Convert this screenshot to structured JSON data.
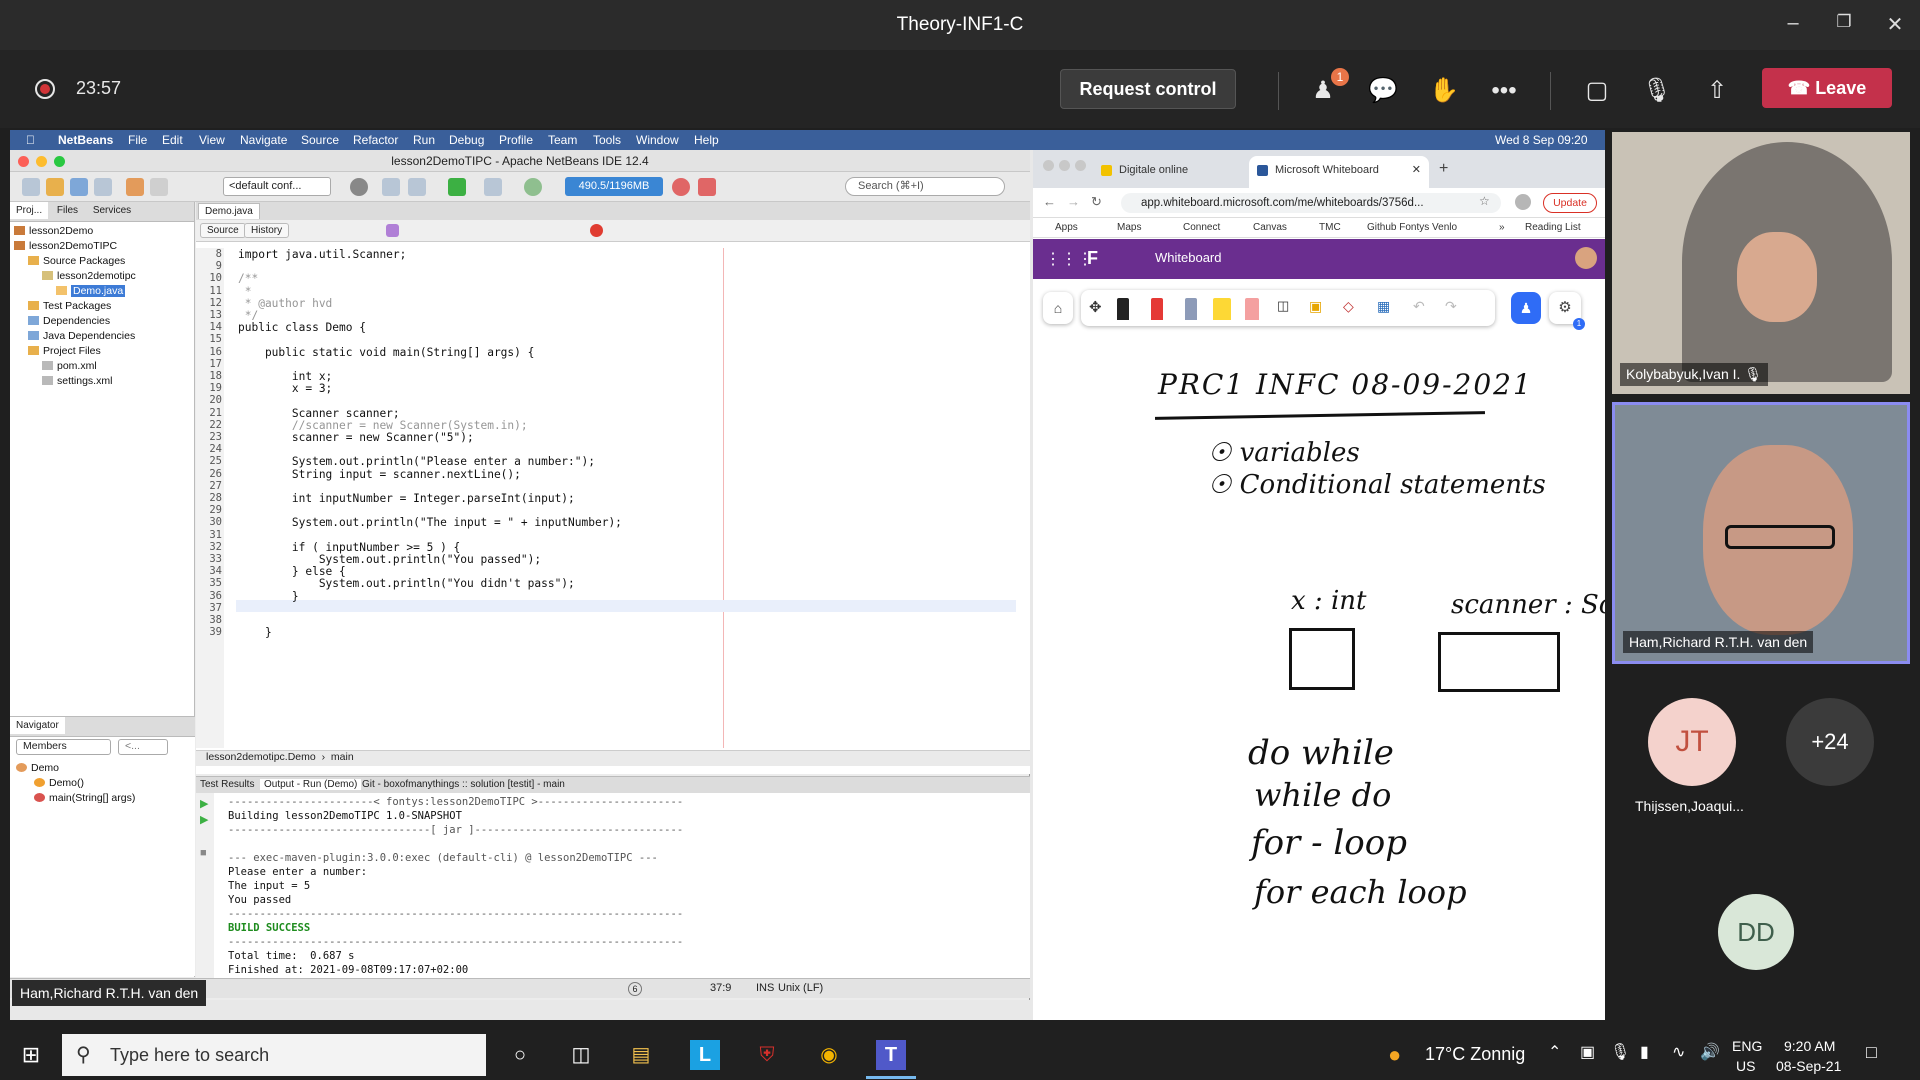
{
  "window": {
    "title": "Theory-INF1-C"
  },
  "call": {
    "timer": "23:57",
    "request_control": "Request control",
    "participants_badge": "1",
    "leave": "Leave",
    "shared_by": "Ham,Richard R.T.H. van den"
  },
  "mac_menubar": {
    "app": "NetBeans",
    "menus": [
      "File",
      "Edit",
      "View",
      "Navigate",
      "Source",
      "Refactor",
      "Run",
      "Debug",
      "Profile",
      "Team",
      "Tools",
      "Window",
      "Help"
    ],
    "clock": "Wed 8 Sep  09:20"
  },
  "netbeans": {
    "title": "lesson2DemoTIPC - Apache NetBeans IDE 12.4",
    "config": "<default conf...",
    "memory": "490.5/1196MB",
    "search_placeholder": "Search (⌘+I)",
    "panel_tabs": [
      "Proj...",
      "Files",
      "Services"
    ],
    "project_tree": [
      "lesson2Demo",
      "lesson2DemoTIPC",
      "Source Packages",
      "lesson2demotipc",
      "Demo.java",
      "Test Packages",
      "Dependencies",
      "Java Dependencies",
      "Project Files",
      "pom.xml",
      "settings.xml"
    ],
    "navigator": {
      "title": "Navigator",
      "filter": "Members",
      "filter2": "<...",
      "items": [
        "Demo",
        "Demo()",
        "main(String[] args)"
      ]
    },
    "editor_tab": "Demo.java",
    "source_tab": "Source",
    "history_tab": "History",
    "code_lines": [
      {
        "n": "8",
        "text": "import java.util.Scanner;"
      },
      {
        "n": "9",
        "text": ""
      },
      {
        "n": "10",
        "text": "/**"
      },
      {
        "n": "11",
        "text": " *"
      },
      {
        "n": "12",
        "text": " * @author hvd"
      },
      {
        "n": "13",
        "text": " */"
      },
      {
        "n": "14",
        "text": "public class Demo {"
      },
      {
        "n": "15",
        "text": ""
      },
      {
        "n": "16",
        "text": "    public static void main(String[] args) {"
      },
      {
        "n": "17",
        "text": ""
      },
      {
        "n": "18",
        "text": "        int x;"
      },
      {
        "n": "19",
        "text": "        x = 3;"
      },
      {
        "n": "20",
        "text": ""
      },
      {
        "n": "21",
        "text": "        Scanner scanner;"
      },
      {
        "n": "22",
        "text": "        //scanner = new Scanner(System.in);"
      },
      {
        "n": "23",
        "text": "        scanner = new Scanner(\"5\");"
      },
      {
        "n": "24",
        "text": ""
      },
      {
        "n": "25",
        "text": "        System.out.println(\"Please enter a number:\");"
      },
      {
        "n": "26",
        "text": "        String input = scanner.nextLine();"
      },
      {
        "n": "27",
        "text": ""
      },
      {
        "n": "28",
        "text": "        int inputNumber = Integer.parseInt(input);"
      },
      {
        "n": "29",
        "text": ""
      },
      {
        "n": "30",
        "text": "        System.out.println(\"The input = \" + inputNumber);"
      },
      {
        "n": "31",
        "text": ""
      },
      {
        "n": "32",
        "text": "        if ( inputNumber >= 5 ) {"
      },
      {
        "n": "33",
        "text": "            System.out.println(\"You passed\");"
      },
      {
        "n": "34",
        "text": "        } else {"
      },
      {
        "n": "35",
        "text": "            System.out.println(\"You didn't pass\");"
      },
      {
        "n": "36",
        "text": "        }"
      },
      {
        "n": "37",
        "text": ""
      },
      {
        "n": "38",
        "text": ""
      },
      {
        "n": "39",
        "text": "    }"
      }
    ],
    "breadcrumb": [
      "lesson2demotipc.Demo",
      "main"
    ],
    "output_tabs": [
      "Test Results",
      "Output - Run (Demo)",
      "Git - boxofmanythings :: solution [testit] - main"
    ],
    "output_lines": [
      "-----------------------< fontys:lesson2DemoTIPC >-----------------------",
      "Building lesson2DemoTIPC 1.0-SNAPSHOT",
      "--------------------------------[ jar ]---------------------------------",
      "",
      "--- exec-maven-plugin:3.0.0:exec (default-cli) @ lesson2DemoTIPC ---",
      "Please enter a number:",
      "The input = 5",
      "You passed",
      "------------------------------------------------------------------------",
      "BUILD SUCCESS",
      "------------------------------------------------------------------------",
      "Total time:  0.687 s",
      "Finished at: 2021-09-08T09:17:07+02:00",
      "------------------------------------------------------------------------"
    ],
    "status_pos": "37:9",
    "status_mode": "INS",
    "status_eol": "Unix (LF)",
    "status_badge": "6"
  },
  "browser": {
    "tabs": [
      "Digitale online Whiteboard-ap...",
      "Microsoft Whiteboard"
    ],
    "url": "app.whiteboard.microsoft.com/me/whiteboards/3756d...",
    "update": "Update",
    "bookmarks": [
      "Apps",
      "Maps",
      "Connect",
      "Canvas",
      "TMC",
      "Github Fontys Venlo",
      "»",
      "Reading List"
    ],
    "app_title": "Whiteboard",
    "settings_badge": "1"
  },
  "whiteboard": {
    "heading": "PRC1  INFC  08-09-2021",
    "items": [
      "variables",
      "Conditional statements"
    ],
    "var1": "x : int",
    "var2": "scanner : Sca",
    "loops": [
      "do while",
      "while do",
      "for - loop",
      "for each loop"
    ]
  },
  "participants": {
    "tile1": "Kolybabyuk,Ivan I.",
    "tile2": "Ham,Richard R.T.H. van den",
    "jt_initials": "JT",
    "jt_name": "Thijssen,Joaqui...",
    "more": "+24",
    "dd_initials": "DD",
    "colors": {
      "jt": "#f4d2cc",
      "dd": "#d9e7d8",
      "more": "#3b3b3b"
    }
  },
  "taskbar": {
    "search_placeholder": "Type here to search",
    "weather": "17°C  Zonnig",
    "lang": "ENG",
    "region": "US",
    "time": "9:20 AM",
    "date": "08-Sep-21"
  }
}
